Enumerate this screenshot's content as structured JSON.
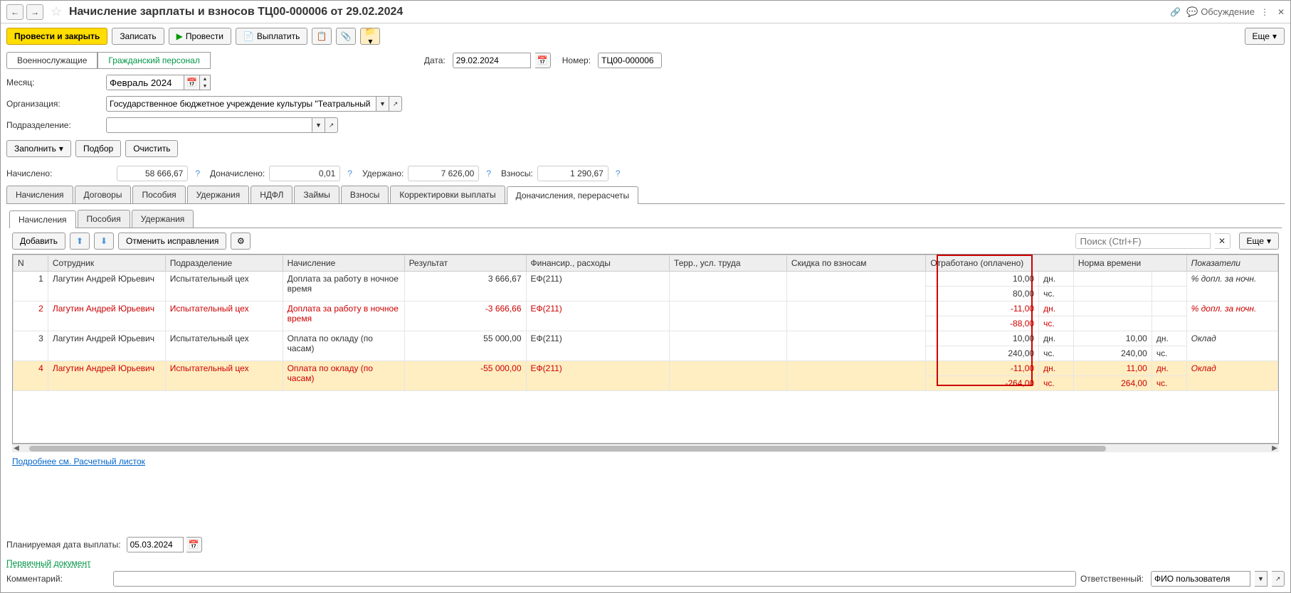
{
  "header": {
    "title": "Начисление зарплаты и взносов ТЦ00-000006 от 29.02.2024",
    "discuss": "Обсуждение"
  },
  "toolbar": {
    "post_close": "Провести и закрыть",
    "save": "Записать",
    "post": "Провести",
    "pay": "Выплатить",
    "more": "Еще"
  },
  "type_tabs": {
    "military": "Военнослужащие",
    "civil": "Гражданский персонал"
  },
  "header_fields": {
    "date_label": "Дата:",
    "date_value": "29.02.2024",
    "number_label": "Номер:",
    "number_value": "ТЦ00-000006"
  },
  "form": {
    "month_label": "Месяц:",
    "month_value": "Февраль 2024",
    "org_label": "Организация:",
    "org_value": "Государственное бюджетное учреждение культуры \"Театральный центр\"",
    "subdiv_label": "Подразделение:",
    "subdiv_value": ""
  },
  "actions": {
    "fill": "Заполнить",
    "select": "Подбор",
    "clear": "Очистить"
  },
  "totals": {
    "accrued_label": "Начислено:",
    "accrued_value": "58 666,67",
    "addl_label": "Доначислено:",
    "addl_value": "0,01",
    "withheld_label": "Удержано:",
    "withheld_value": "7 626,00",
    "contrib_label": "Взносы:",
    "contrib_value": "1 290,67"
  },
  "main_tabs": [
    "Начисления",
    "Договоры",
    "Пособия",
    "Удержания",
    "НДФЛ",
    "Займы",
    "Взносы",
    "Корректировки выплаты",
    "Доначисления, перерасчеты"
  ],
  "main_tab_active": 8,
  "sub_tabs": [
    "Начисления",
    "Пособия",
    "Удержания"
  ],
  "sub_tab_active": 0,
  "table_toolbar": {
    "add": "Добавить",
    "cancel_fix": "Отменить исправления",
    "search_placeholder": "Поиск (Ctrl+F)",
    "more": "Еще"
  },
  "columns": {
    "n": "N",
    "employee": "Сотрудник",
    "dept": "Подразделение",
    "accrual": "Начисление",
    "result": "Результат",
    "finance": "Финансир., расходы",
    "terr": "Терр., усл. труда",
    "discount": "Скидка по взносам",
    "worked": "Отработано (оплачено)",
    "norm": "Норма времени",
    "indicators": "Показатели"
  },
  "rows": [
    {
      "n": "1",
      "emp": "Лагутин Андрей Юрьевич",
      "dep": "Испытательный цех",
      "accr": "Доплата за работу в ночное время",
      "res": "3 666,67",
      "fin": "ЕФ(211)",
      "days": "10,00",
      "hours": "80,00",
      "ndays": "",
      "nhours": "",
      "ind": "% допл. за ночн.",
      "red": false,
      "yellow": false
    },
    {
      "n": "2",
      "emp": "Лагутин Андрей Юрьевич",
      "dep": "Испытательный цех",
      "accr": "Доплата за работу в ночное время",
      "res": "-3 666,66",
      "fin": "ЕФ(211)",
      "days": "-11,00",
      "hours": "-88,00",
      "ndays": "",
      "nhours": "",
      "ind": "% допл. за ночн.",
      "red": true,
      "yellow": false
    },
    {
      "n": "3",
      "emp": "Лагутин Андрей Юрьевич",
      "dep": "Испытательный цех",
      "accr": "Оплата по окладу (по часам)",
      "res": "55 000,00",
      "fin": "ЕФ(211)",
      "days": "10,00",
      "hours": "240,00",
      "ndays": "10,00",
      "nhours": "240,00",
      "ind": "Оклад",
      "red": false,
      "yellow": false
    },
    {
      "n": "4",
      "emp": "Лагутин Андрей Юрьевич",
      "dep": "Испытательный цех",
      "accr": "Оплата по окладу (по часам)",
      "res": "-55 000,00",
      "fin": "ЕФ(211)",
      "days": "-11,00",
      "hours": "-264,00",
      "ndays": "11,00",
      "nhours": "264,00",
      "ind": "Оклад",
      "red": true,
      "yellow": true
    }
  ],
  "units": {
    "dn": "дн.",
    "ch": "чс."
  },
  "footer_link": "Подробнее см. Расчетный листок",
  "bottom": {
    "plan_label": "Планируемая дата выплаты:",
    "plan_value": "05.03.2024",
    "primary_doc": "Первичный документ",
    "comment_label": "Комментарий:",
    "resp_label": "Ответственный:",
    "resp_value": "ФИО пользователя"
  }
}
